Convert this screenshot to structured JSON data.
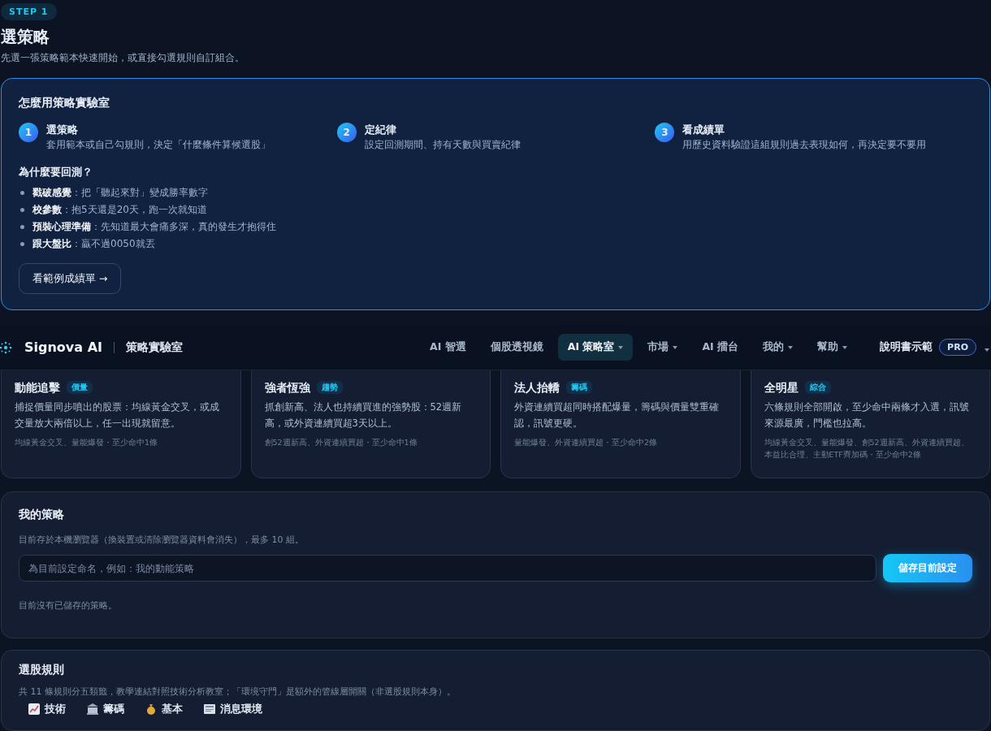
{
  "step_badge": "STEP 1",
  "title": "選策略",
  "subtitle": "先選一張策略範本快速開始，或直接勾選規則自訂組合。",
  "guide": {
    "title": "怎麼用策略實驗室",
    "steps": [
      {
        "number": "1",
        "title": "選策略",
        "desc": "套用範本或自己勾規則，決定「什麼條件算候選股」"
      },
      {
        "number": "2",
        "title": "定紀律",
        "desc": "設定回測期間、持有天數與買賣紀律"
      },
      {
        "number": "3",
        "title": "看成績單",
        "desc": "用歷史資料驗證這組規則過去表現如何，再決定要不要用"
      }
    ],
    "why_title": "為什麼要回測？",
    "reasons": [
      "**戳破感覺**：把「聽起來對」變成勝率數字",
      "**校參數**：抱5天還是20天，跑一次就知道",
      "**預裝心理準備**：先知道最大會痛多深，真的發生才抱得住",
      "**跟大盤比**：贏不過0050就丟"
    ],
    "button": "看範例成績單 →"
  },
  "templates": [
    {
      "name": "動能追擊",
      "tag": "價量",
      "desc": "捕捉價量同步噴出的股票：均線黃金交叉，或成交量放大兩倍以上，任一出現就留意。",
      "rules": "均線黃金交叉、量能爆發・至少命中1條"
    },
    {
      "name": "強者恆強",
      "tag": "趨勢",
      "desc": "抓創新高、法人也持續買進的強勢股：52週新高，或外資連續買超3天以上。",
      "rules": "創52週新高、外資連續買超・至少命中1條"
    },
    {
      "name": "法人抬轎",
      "tag": "籌碼",
      "desc": "外資連續買超同時搭配爆量，籌碼與價量雙重確認，訊號更硬。",
      "rules": "量能爆發、外資連續買超・至少命中2條"
    },
    {
      "name": "全明星",
      "tag": "綜合",
      "desc": "六條規則全部開啟，至少命中兩條才入選，訊號來源最廣，門檻也拉高。",
      "rules": "均線黃金交叉、量能爆發、創52週新高、外資連續買超、本益比合理、主動ETF齊加碼・至少命中2條"
    }
  ],
  "nav": {
    "brand": "Signova AI",
    "section": "策略實驗室",
    "items": [
      {
        "label": "AI 智選",
        "selected": false,
        "dropdown": false
      },
      {
        "label": "個股透視鏡",
        "selected": false,
        "dropdown": false
      },
      {
        "label": "AI 策略室",
        "selected": true,
        "dropdown": true
      },
      {
        "label": "市場",
        "selected": false,
        "dropdown": true
      },
      {
        "label": "AI 擂台",
        "selected": false,
        "dropdown": false
      },
      {
        "label": "我的",
        "selected": false,
        "dropdown": true
      },
      {
        "label": "幫助",
        "selected": false,
        "dropdown": true
      }
    ],
    "user": "說明書示範",
    "plan": "PRO"
  },
  "my_strategies": {
    "title": "我的策略",
    "note": "目前存於本機瀏覽器（換裝置或清除瀏覽器資料會消失），最多 10 組。",
    "placeholder": "為目前設定命名，例如：我的動能策略",
    "save_button": "儲存目前設定",
    "empty": "目前沒有已儲存的策略。"
  },
  "rules": {
    "title": "選股規則",
    "note": "共 11 條規則分五類籤，教學連結對照技術分析教室；「環境守門」是額外的管線層開關（非選股規則本身）。",
    "categories": [
      {
        "label": "技術",
        "kind": "chart"
      },
      {
        "label": "籌碼",
        "kind": "bank"
      },
      {
        "label": "基本",
        "kind": "money"
      },
      {
        "label": "消息環境",
        "kind": "news"
      }
    ]
  }
}
